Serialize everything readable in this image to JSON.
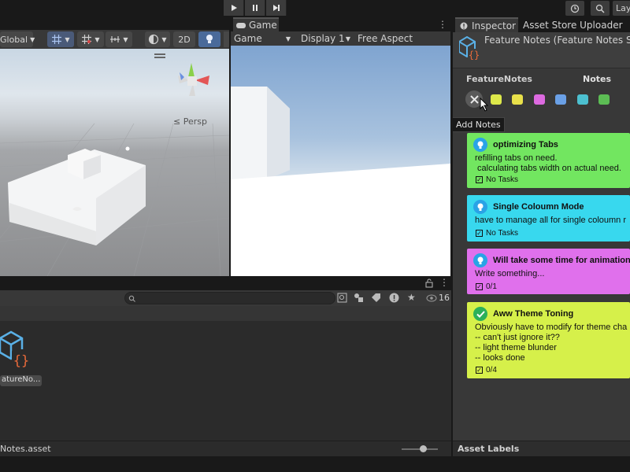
{
  "toolbar": {
    "play_icon": "play-icon",
    "pause_icon": "pause-icon",
    "step_icon": "step-icon",
    "layers_label": "Lay"
  },
  "scene": {
    "global_label": "Global",
    "mode_2d": "2D",
    "persp_label": "Persp"
  },
  "game": {
    "tab_label": "Game",
    "display_select": "Game",
    "display_number": "Display 1",
    "aspect": "Free Aspect"
  },
  "project": {
    "search_placeholder": "",
    "count": "16",
    "asset_label": "atureNo...",
    "footer_path": "Notes.asset"
  },
  "inspector": {
    "tab_inspector": "Inspector",
    "tab_uploader": "Asset Store Uploader",
    "object_title": "Feature Notes (Feature Notes SO",
    "section_left": "FeatureNotes",
    "section_right": "Notes",
    "tooltip": "Add Notes",
    "footer_label": "Asset Labels",
    "swatch_colors": [
      "#dde84a",
      "#e8e04a",
      "#dd6ae0",
      "#6aa0e6",
      "#4cc0d0",
      "#5cbd54"
    ],
    "notes": [
      {
        "title": "optimizing Tabs",
        "body": "refilling tabs on need.\n calculating tabs width on actual need.",
        "tasks": "No Tasks",
        "color": "#72e660",
        "icon": "lightbulb-icon",
        "badge_color": "#29a3e6"
      },
      {
        "title": "Single Coloumn Mode",
        "body": "have to manage all for single coloumn r",
        "tasks": "No Tasks",
        "color": "#38d8ee",
        "icon": "lightbulb-icon",
        "badge_color": "#29a3e6"
      },
      {
        "title": "Will take some time for animations",
        "body": "Write something...",
        "tasks": "0/1",
        "color": "#e070ec",
        "icon": "lightbulb-icon",
        "badge_color": "#29a3e6"
      },
      {
        "title": "Aww Theme Toning",
        "body": "Obviously have to modify for theme cha\n-- can't just ignore it??\n-- light theme blunder\n-- looks done",
        "tasks": "0/4",
        "color": "#d6f04a",
        "icon": "checkmark-icon",
        "badge_color": "#2bb05a"
      }
    ]
  }
}
